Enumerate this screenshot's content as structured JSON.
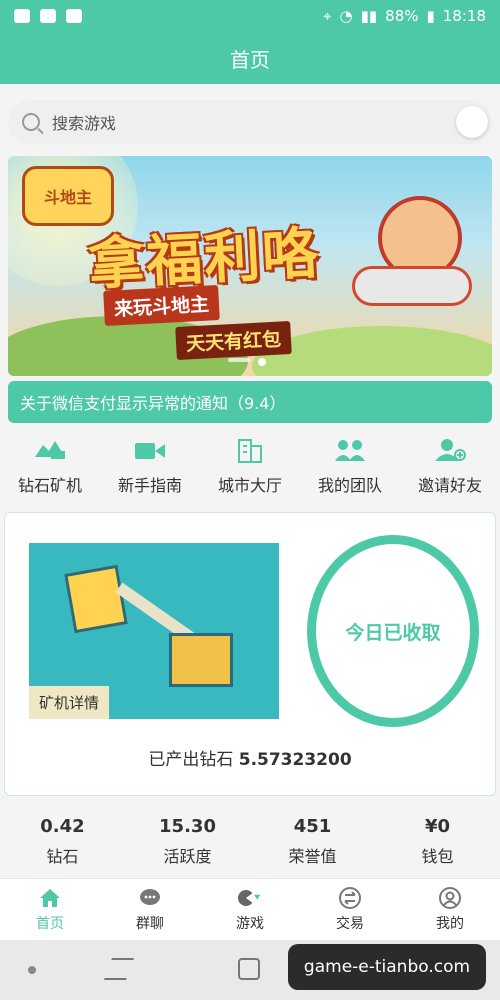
{
  "status_bar": {
    "battery": "88%",
    "time": "18:18"
  },
  "header": {
    "title": "首页"
  },
  "search": {
    "placeholder": "搜索游戏"
  },
  "banner": {
    "logo_text": "斗地主",
    "title": "拿福利咯",
    "subtitle1": "来玩斗地主",
    "subtitle2": "天天有红包"
  },
  "notice": {
    "text": "关于微信支付显示异常的通知（9.4）"
  },
  "quick_nav": [
    {
      "label": "钻石矿机",
      "icon": "diamond-mine-icon"
    },
    {
      "label": "新手指南",
      "icon": "video-camera-icon"
    },
    {
      "label": "城市大厅",
      "icon": "building-icon"
    },
    {
      "label": "我的团队",
      "icon": "team-icon"
    },
    {
      "label": "邀请好友",
      "icon": "add-user-icon"
    }
  ],
  "mining": {
    "details_tag": "矿机详情",
    "collect_status": "今日已收取",
    "produced_label": "已产出钻石",
    "produced_value": "5.57323200"
  },
  "stats": [
    {
      "value": "0.42",
      "label": "钻石"
    },
    {
      "value": "15.30",
      "label": "活跃度"
    },
    {
      "value": "451",
      "label": "荣誉值"
    },
    {
      "value": "¥0",
      "label": "钱包"
    }
  ],
  "tab_bar": [
    {
      "label": "首页",
      "icon": "home-icon",
      "active": true
    },
    {
      "label": "群聊",
      "icon": "chat-icon",
      "active": false
    },
    {
      "label": "游戏",
      "icon": "game-icon",
      "active": false
    },
    {
      "label": "交易",
      "icon": "exchange-icon",
      "active": false
    },
    {
      "label": "我的",
      "icon": "profile-icon",
      "active": false
    }
  ],
  "watermark": {
    "text": "game-e-tianbo.com"
  },
  "colors": {
    "accent": "#4ec9a8"
  }
}
